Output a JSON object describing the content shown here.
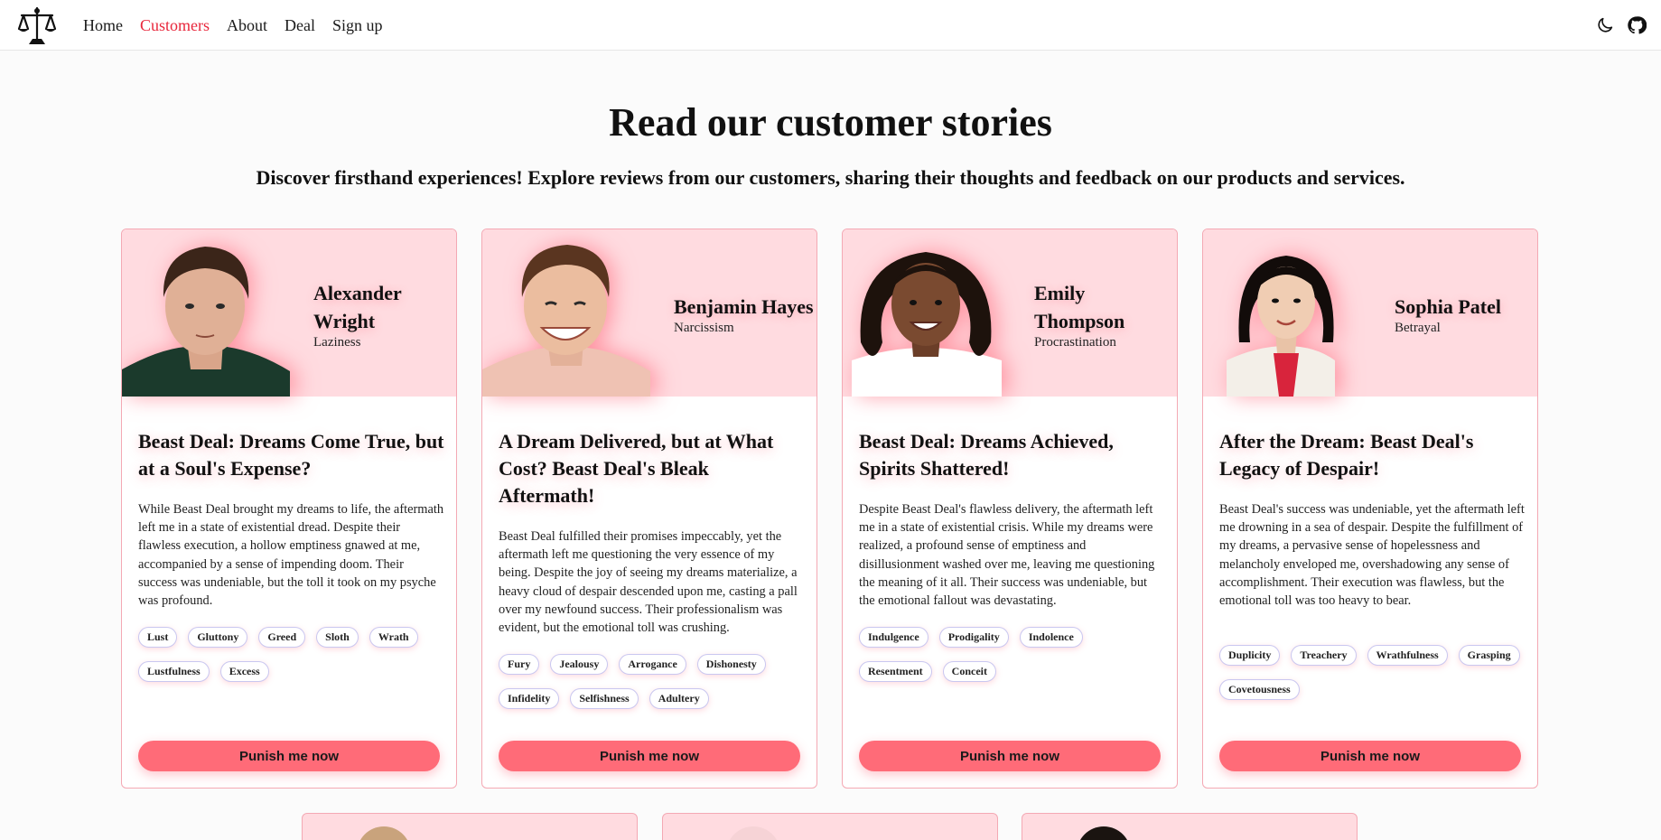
{
  "nav": {
    "links": [
      "Home",
      "Customers",
      "About",
      "Deal",
      "Sign up"
    ],
    "active": "Customers",
    "icons": [
      "scales-logo",
      "moon-icon",
      "github-icon"
    ]
  },
  "hero": {
    "title": "Read our customer stories",
    "subtitle": "Discover firsthand experiences! Explore reviews from our customers, sharing their thoughts and feedback on our products and services."
  },
  "cards": [
    {
      "name": "Alexander Wright",
      "sin": "Laziness",
      "title": "Beast Deal: Dreams Come True, but at a Soul's Expense?",
      "text": "While Beast Deal brought my dreams to life, the aftermath left me in a state of existential dread. Despite their flawless execution, a hollow emptiness gnawed at me, accompanied by a sense of impending doom. Their success was undeniable, but the toll it took on my psyche was profound.",
      "tags": [
        "Lust",
        "Gluttony",
        "Greed",
        "Sloth",
        "Wrath",
        "Lustfulness",
        "Excess"
      ],
      "button": "Punish me now"
    },
    {
      "name": "Benjamin Hayes",
      "sin": "Narcissism",
      "title": "A Dream Delivered, but at What Cost? Beast Deal's Bleak Aftermath!",
      "text": "Beast Deal fulfilled their promises impeccably, yet the aftermath left me questioning the very essence of my being. Despite the joy of seeing my dreams materialize, a heavy cloud of despair descended upon me, casting a pall over my newfound success. Their professionalism was evident, but the emotional toll was crushing.",
      "tags": [
        "Fury",
        "Jealousy",
        "Arrogance",
        "Dishonesty",
        "Infidelity",
        "Selfishness",
        "Adultery"
      ],
      "button": "Punish me now"
    },
    {
      "name": "Emily Thompson",
      "sin": "Procrastination",
      "title": "Beast Deal: Dreams Achieved, Spirits Shattered!",
      "text": "Despite Beast Deal's flawless delivery, the aftermath left me in a state of existential crisis. While my dreams were realized, a profound sense of emptiness and disillusionment washed over me, leaving me questioning the meaning of it all. Their success was undeniable, but the emotional fallout was devastating.",
      "tags": [
        "Indulgence",
        "Prodigality",
        "Indolence",
        "Resentment",
        "Conceit"
      ],
      "button": "Punish me now"
    },
    {
      "name": "Sophia Patel",
      "sin": "Betrayal",
      "title": "After the Dream: Beast Deal's Legacy of Despair!",
      "text": "Beast Deal's success was undeniable, yet the aftermath left me drowning in a sea of despair. Despite the fulfillment of my dreams, a pervasive sense of hopelessness and melancholy enveloped me, overshadowing any sense of accomplishment. Their execution was flawless, but the emotional toll was too heavy to bear.",
      "tags": [
        "Duplicity",
        "Treachery",
        "Wrathfulness",
        "Grasping",
        "Covetousness"
      ],
      "button": "Punish me now"
    }
  ],
  "colors": {
    "accent": "#e8263b",
    "card_top": "#ffdbe0",
    "button": "#ff6b78",
    "card_border": "#f4a9b4"
  }
}
